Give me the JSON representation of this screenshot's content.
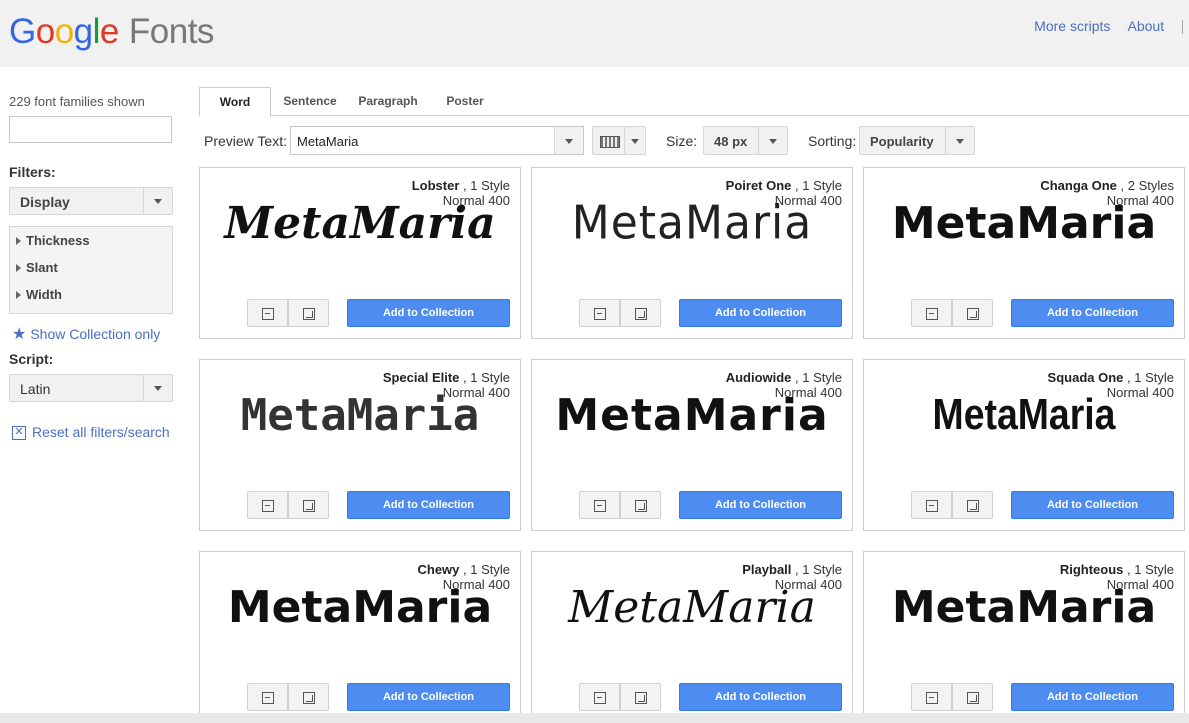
{
  "header": {
    "logo_google": [
      "G",
      "o",
      "o",
      "g",
      "l",
      "e"
    ],
    "logo_fonts": "Fonts",
    "links": [
      "More scripts",
      "About"
    ]
  },
  "sidebar": {
    "count_text": "229 font families shown",
    "search_placeholder": "",
    "filters_label": "Filters:",
    "category_select": "Display",
    "filter_items": [
      "Thickness",
      "Slant",
      "Width"
    ],
    "show_collection": "Show Collection only",
    "script_label": "Script:",
    "script_select": "Latin",
    "reset": "Reset all filters/search"
  },
  "tabs": [
    "Word",
    "Sentence",
    "Paragraph",
    "Poster"
  ],
  "controls": {
    "preview_label": "Preview Text:",
    "preview_value": "MetaMaria",
    "size_label": "Size:",
    "size_value": "48 px",
    "sorting_label": "Sorting:",
    "sorting_value": "Popularity"
  },
  "cards": [
    {
      "name": "Lobster",
      "styles": "1 Style",
      "weight": "Normal 400",
      "preview": "MetaMaria",
      "button": "Add to Collection"
    },
    {
      "name": "Poiret One",
      "styles": "1 Style",
      "weight": "Normal 400",
      "preview": "MetaMaria",
      "button": "Add to Collection"
    },
    {
      "name": "Changa One",
      "styles": "2 Styles",
      "weight": "Normal 400",
      "preview": "MetaMaria",
      "button": "Add to Collection"
    },
    {
      "name": "Special Elite",
      "styles": "1 Style",
      "weight": "Normal 400",
      "preview": "MetaMaria",
      "button": "Add to Collection"
    },
    {
      "name": "Audiowide",
      "styles": "1 Style",
      "weight": "Normal 400",
      "preview": "MetaMaria",
      "button": "Add to Collection"
    },
    {
      "name": "Squada One",
      "styles": "1 Style",
      "weight": "Normal 400",
      "preview": "MetaMaria",
      "button": "Add to Collection"
    },
    {
      "name": "Chewy",
      "styles": "1 Style",
      "weight": "Normal 400",
      "preview": "MetaMaria",
      "button": "Add to Collection"
    },
    {
      "name": "Playball",
      "styles": "1 Style",
      "weight": "Normal 400",
      "preview": "MetaMaria",
      "button": "Add to Collection"
    },
    {
      "name": "Righteous",
      "styles": "1 Style",
      "weight": "Normal 400",
      "preview": "MetaMaria",
      "button": "Add to Collection"
    }
  ],
  "colors": {
    "accent": "#4d8df1",
    "link": "#4a6fc4"
  }
}
